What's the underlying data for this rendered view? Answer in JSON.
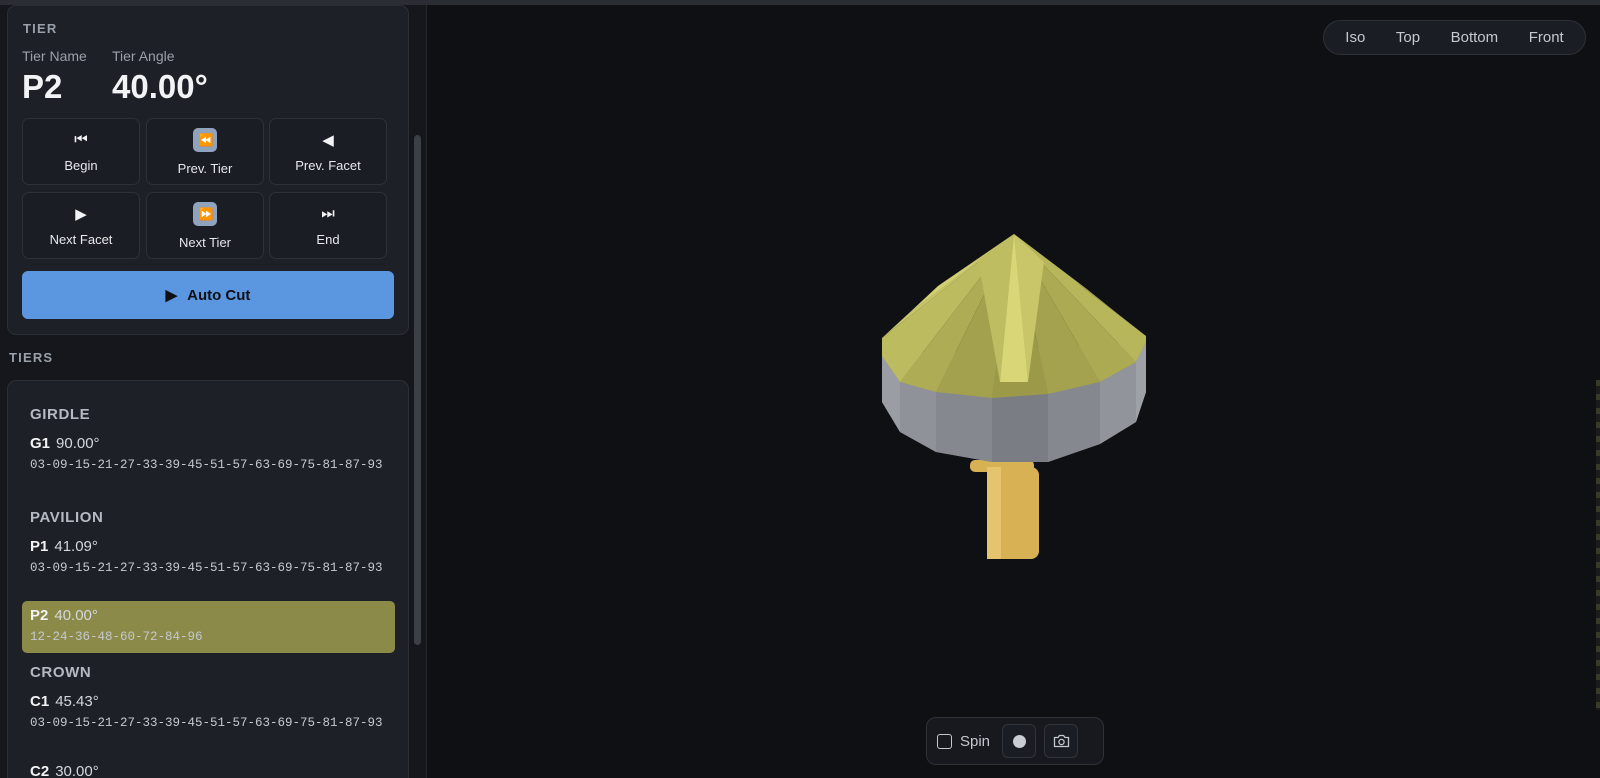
{
  "tier_panel": {
    "section": "TIER",
    "name_label": "Tier Name",
    "name_value": "P2",
    "angle_label": "Tier Angle",
    "angle_value": "40.00°"
  },
  "nav_buttons": [
    {
      "label": "Begin",
      "icon": "⏮",
      "icon_name": "skip-to-start-icon"
    },
    {
      "label": "Prev. Tier",
      "icon": "⏪",
      "icon_name": "rewind-icon"
    },
    {
      "label": "Prev. Facet",
      "icon": "◀",
      "icon_name": "play-reverse-icon"
    },
    {
      "label": "Next Facet",
      "icon": "▶",
      "icon_name": "play-icon"
    },
    {
      "label": "Next Tier",
      "icon": "⏩",
      "icon_name": "fast-forward-icon"
    },
    {
      "label": "End",
      "icon": "⏭",
      "icon_name": "skip-to-end-icon"
    }
  ],
  "auto_cut": {
    "label": "Auto Cut",
    "icon": "▶"
  },
  "tiers_section": "TIERS",
  "tier_groups": [
    {
      "title": "GIRDLE",
      "items": [
        {
          "name": "G1",
          "angle": "90.00°",
          "sequence": "03-09-15-21-27-33-39-45-51-57-63-69-75-81-87-93",
          "active": false
        }
      ]
    },
    {
      "title": "PAVILION",
      "items": [
        {
          "name": "P1",
          "angle": "41.09°",
          "sequence": "03-09-15-21-27-33-39-45-51-57-63-69-75-81-87-93",
          "active": false
        },
        {
          "name": "P2",
          "angle": "40.00°",
          "sequence": "12-24-36-48-60-72-84-96",
          "active": true
        }
      ]
    },
    {
      "title": "CROWN",
      "items": [
        {
          "name": "C1",
          "angle": "45.43°",
          "sequence": "03-09-15-21-27-33-39-45-51-57-63-69-75-81-87-93",
          "active": false
        },
        {
          "name": "C2",
          "angle": "30.00°",
          "sequence": "",
          "active": false
        }
      ]
    }
  ],
  "view_buttons": [
    "Iso",
    "Top",
    "Bottom",
    "Front"
  ],
  "bottom_bar": {
    "spin_label": "Spin"
  },
  "colors": {
    "accent": "#5b96e1",
    "active_tier": "#8c8a48",
    "gem_crown": "#b6b35a",
    "gem_girdle": "#8a8d93",
    "dop": "#d9b155"
  }
}
